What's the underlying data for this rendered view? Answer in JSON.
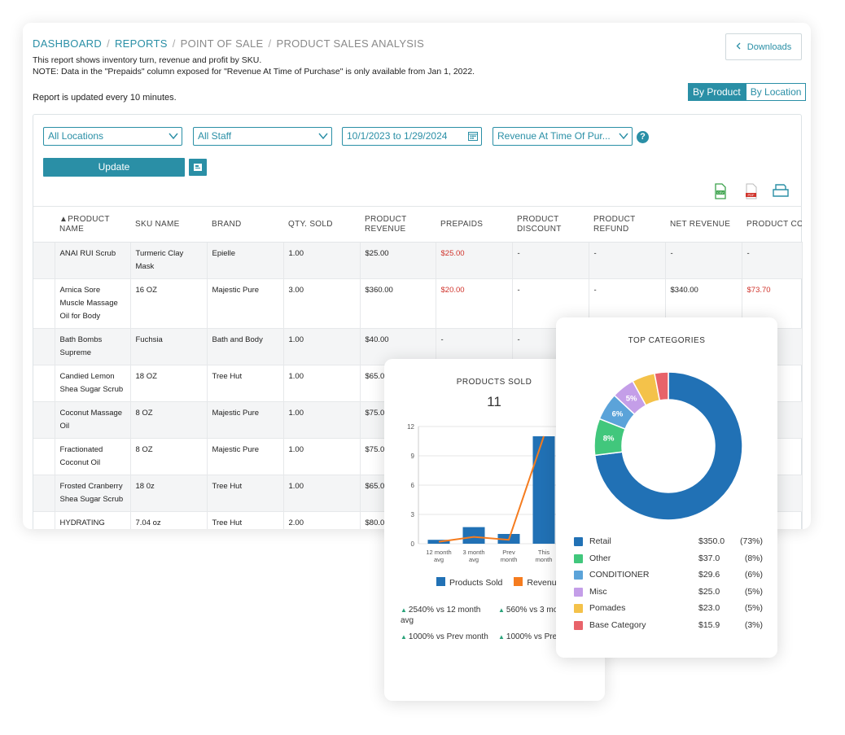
{
  "breadcrumb": {
    "dashboard": "DASHBOARD",
    "reports": "REPORTS",
    "pos": "POINT OF SALE",
    "current": "PRODUCT SALES ANALYSIS",
    "sep": "/"
  },
  "description": {
    "line1": "This report shows inventory turn, revenue and profit by SKU.",
    "line2": "NOTE: Data in the \"Prepaids\" column exposed for \"Revenue At Time of Purchase\" is only available from Jan 1, 2022."
  },
  "updated_note": "Report is updated every 10 minutes.",
  "downloads_label": "Downloads",
  "view_toggle": {
    "by_product": "By Product",
    "by_location": "By Location"
  },
  "filters": {
    "location": "All Locations",
    "staff": "All Staff",
    "date_range": "10/1/2023 to 1/29/2024",
    "revenue_basis": "Revenue At Time Of Pur..."
  },
  "help_label": "?",
  "update_label": "Update",
  "table": {
    "columns": [
      "▲PRODUCT NAME",
      "SKU NAME",
      "BRAND",
      "QTY. SOLD",
      "PRODUCT REVENUE",
      "PREPAIDS",
      "PRODUCT DISCOUNT",
      "PRODUCT REFUND",
      "NET REVENUE",
      "PRODUCT CO"
    ],
    "rows": [
      [
        "ANAI RUI Scrub",
        "Turmeric Clay Mask",
        "Epielle",
        "1.00",
        "$25.00",
        "$25.00",
        "-",
        "-",
        "-",
        "-"
      ],
      [
        "Arnica Sore Muscle Massage Oil for Body",
        "16 OZ",
        "Majestic Pure",
        "3.00",
        "$360.00",
        "$20.00",
        "-",
        "-",
        "$340.00",
        "$73.70"
      ],
      [
        "Bath Bombs Supreme",
        "Fuchsia",
        "Bath and Body",
        "1.00",
        "$40.00",
        "-",
        "-",
        "",
        "",
        ""
      ],
      [
        "Candied Lemon Shea Sugar Scrub",
        "18 OZ",
        "Tree Hut",
        "1.00",
        "$65.00",
        "",
        "",
        "",
        "",
        ""
      ],
      [
        "Coconut Massage Oil",
        "8 OZ",
        "Majestic Pure",
        "1.00",
        "$75.00",
        "",
        "",
        "",
        "",
        ""
      ],
      [
        "Fractionated Coconut Oil",
        "8 OZ",
        "Majestic Pure",
        "1.00",
        "$75.00",
        "",
        "",
        "",
        "",
        ""
      ],
      [
        "Frosted Cranberry Shea Sugar Scrub",
        "18 0z",
        "Tree Hut",
        "1.00",
        "$65.00",
        "",
        "",
        "",
        "",
        ""
      ],
      [
        "HYDRATING WATERMELON & CACTUS FACE",
        "7.04 oz",
        "Tree Hut",
        "2.00",
        "$80.00",
        "",
        "",
        "",
        "",
        ""
      ]
    ]
  },
  "products_sold": {
    "title": "PRODUCTS SOLD",
    "count": "11",
    "legend": [
      "Products Sold",
      "Revenue"
    ],
    "stats": [
      "2540% vs 12 month avg",
      "560% vs 3 mo",
      "1000% vs Prev month",
      "1000% vs Prev"
    ],
    "colors": {
      "bars": "#2171b5",
      "line": "#f57c1f",
      "up": "#2aa37a"
    }
  },
  "chart_data": [
    {
      "type": "bar",
      "title": "PRODUCTS SOLD",
      "categories": [
        "12 month avg",
        "3 month avg",
        "Prev month",
        "This month"
      ],
      "series": [
        {
          "name": "Products Sold",
          "values": [
            0.4,
            1.7,
            1.0,
            11
          ]
        },
        {
          "name": "Revenue",
          "values": [
            0.2,
            0.7,
            0.4,
            11
          ]
        }
      ],
      "ylim": [
        0,
        12
      ],
      "yticks": [
        0,
        3,
        6,
        9,
        12
      ]
    },
    {
      "type": "pie",
      "title": "TOP CATEGORIES",
      "categories": [
        "Retail",
        "Other",
        "CONDITIONER",
        "Misc",
        "Pomades",
        "Base Category"
      ],
      "values": [
        73,
        8,
        6,
        5,
        5,
        3
      ],
      "labels": [
        "73%",
        "8%",
        "6%",
        "5%",
        "",
        ""
      ],
      "colors": [
        "#2171b5",
        "#41c77c",
        "#5ba3d9",
        "#c49ee8",
        "#f4c24a",
        "#e8636a"
      ]
    }
  ],
  "top_categories": {
    "title": "TOP CATEGORIES",
    "rows": [
      {
        "name": "Retail",
        "amount": "$350.0",
        "pct": "(73%)"
      },
      {
        "name": "Other",
        "amount": "$37.0",
        "pct": "(8%)"
      },
      {
        "name": "CONDITIONER",
        "amount": "$29.6",
        "pct": "(6%)"
      },
      {
        "name": "Misc",
        "amount": "$25.0",
        "pct": "(5%)"
      },
      {
        "name": "Pomades",
        "amount": "$23.0",
        "pct": "(5%)"
      },
      {
        "name": "Base Category",
        "amount": "$15.9",
        "pct": "(3%)"
      }
    ]
  }
}
